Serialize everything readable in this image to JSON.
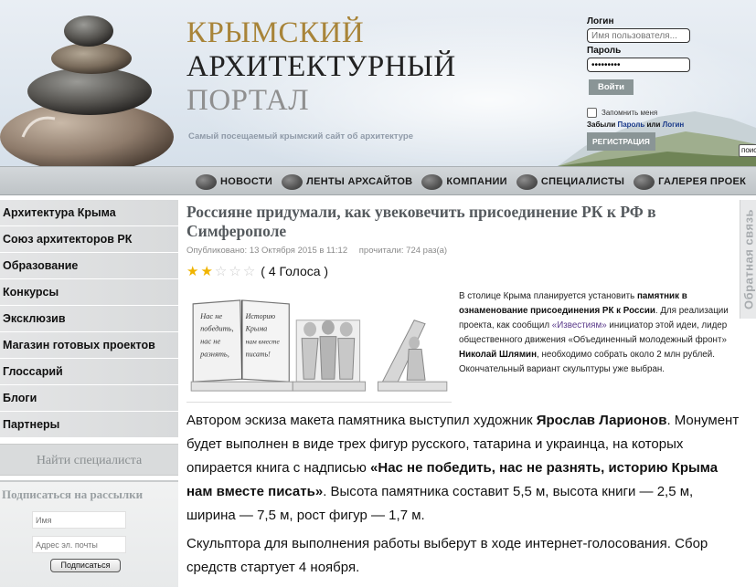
{
  "header": {
    "logo_line1": "КРЫМСКИЙ",
    "logo_line2": "АРХИТЕКТУРНЫЙ",
    "logo_line3": "ПОРТАЛ",
    "tagline": "Самый посещаемый крымский сайт об архитектуре",
    "search_placeholder": "поис"
  },
  "login": {
    "login_label": "Логин",
    "login_placeholder": "Имя пользователя...",
    "password_label": "Пароль",
    "password_value": "•••••••••",
    "submit_label": "Войти",
    "remember_label": "Запомнить меня",
    "forgot_prefix": "Забыли",
    "forgot_password": "Пароль",
    "forgot_or": "или",
    "forgot_login": "Логин",
    "register_label": "РЕГИСТРАЦИЯ"
  },
  "nav": {
    "items": [
      "НОВОСТИ",
      "ЛЕНТЫ АРХСАЙТОВ",
      "КОМПАНИИ",
      "СПЕЦИАЛИСТЫ",
      "ГАЛЕРЕЯ ПРОЕК"
    ]
  },
  "sidebar": {
    "items": [
      "Архитектура Крыма",
      "Союз архитекторов РК",
      "Образование",
      "Конкурсы",
      "Эксклюзив",
      "Магазин готовых проектов",
      "Глоссарий",
      "Блоги",
      "Партнеры"
    ],
    "find_specialist": "Найти специалиста",
    "subscribe_title": "Подписаться на рассылки",
    "name_placeholder": "Имя",
    "email_placeholder": "Адрес эл. почты",
    "subscribe_button": "Подписаться"
  },
  "article": {
    "title": "Россияне придумали, как увековечить присоединение РК к РФ в Симферополе",
    "published": "Опубликовано: 13 Октября 2015 в 11:12",
    "views": "прочитали: 724 раз(а)",
    "rating": {
      "value": 2,
      "max": 5,
      "votes_label": "( 4 Голоса )"
    },
    "lead": {
      "t1": "В столице Крыма планируется установить ",
      "b1": "памятник в ознаменование присоединения РК к России",
      "t2": ". Для реализации проекта, как сообщил ",
      "link": "«Известиям»",
      "t3": " инициатор этой идеи, лидер общественного движения «Объединенный молодежный фронт» ",
      "b2": "Николай Шлямин",
      "t4": ", необходимо собрать около 2 млн рублей. Окончательный вариант скульптуры уже выбран."
    },
    "p1": {
      "t1": "Автором эскиза макета памятника выступил художник ",
      "b1": "Ярослав Ларионов",
      "t2": ". Монумент будет выполнен в виде трех фигур русского, татарина и украинца, на которых опирается книга с надписью ",
      "b2": "«Нас не победить, нас не разнять, историю Крыма нам вместе писать»",
      "t3": ". Высота памятника составит 5,5 м, высота книги — 2,5 м, ширина — 7,5 м, рост фигур — 1,7 м."
    },
    "p2": "Скульптора для выполнения работы выберут в ходе интернет-голосования. Сбор средств стартует 4 ноября.",
    "book_text_left": [
      "Нас не",
      "победить,",
      "нас не",
      "разнять,"
    ],
    "book_text_right": [
      "Историю",
      "Крыма",
      "нам вместе",
      "писать!"
    ]
  },
  "feedback_label": "Обратная связь",
  "colors": {
    "logo_gold": "#a88439",
    "nav_bg": "#c7cbce",
    "button_gray": "#8a9596",
    "star": "#f0b400"
  }
}
